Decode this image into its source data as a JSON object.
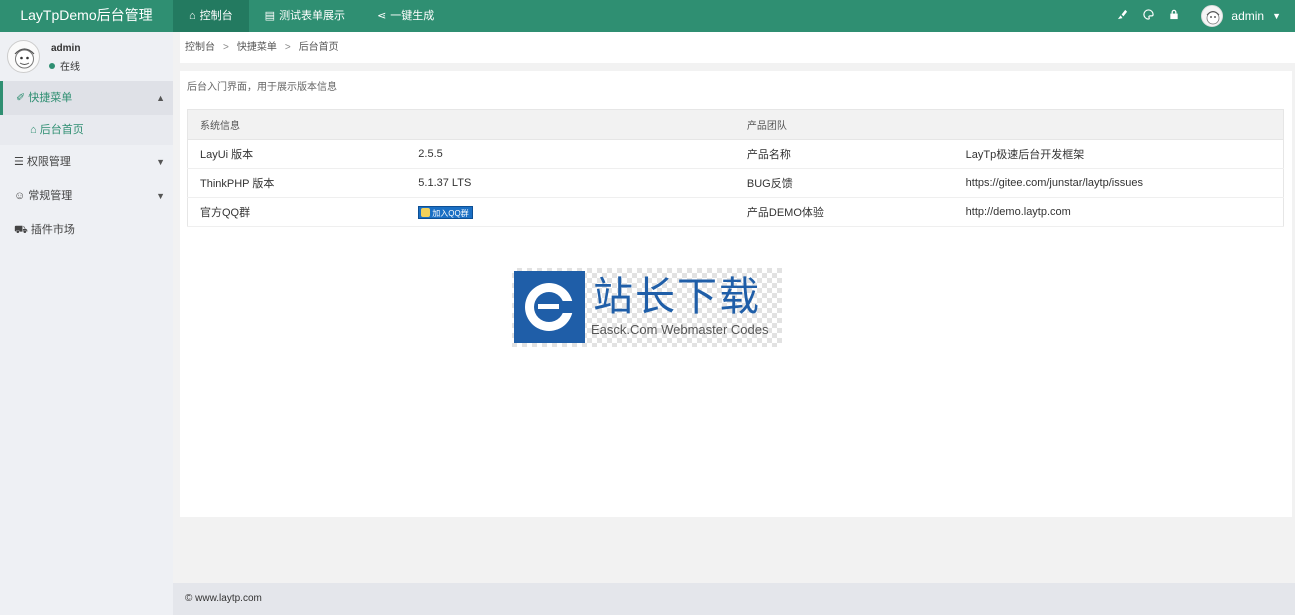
{
  "header": {
    "logo": "LayTpDemo后台管理",
    "nav": [
      {
        "icon": "⌂",
        "label": "控制台"
      },
      {
        "icon": "▤",
        "label": "测试表单展示"
      },
      {
        "icon": "⋖",
        "label": "一键生成"
      }
    ],
    "icons": [
      "broom-icon",
      "palette-icon",
      "lock-icon"
    ],
    "user": {
      "name": "admin"
    }
  },
  "sidebar": {
    "user": {
      "name": "admin",
      "status": "在线"
    },
    "menu": [
      {
        "icon": "✐",
        "label": "快捷菜单",
        "open": true,
        "children": [
          {
            "icon": "⌂",
            "label": "后台首页"
          }
        ]
      },
      {
        "icon": "☰",
        "label": "权限管理"
      },
      {
        "icon": "☺",
        "label": "常规管理"
      },
      {
        "icon": "⛟",
        "label": "插件市场"
      }
    ]
  },
  "breadcrumb": [
    "控制台",
    "快捷菜单",
    "后台首页"
  ],
  "main": {
    "intro": "后台入门界面，用于展示版本信息",
    "table": {
      "headers": [
        "系统信息",
        "产品团队"
      ],
      "rows": [
        [
          "LayUi 版本",
          "2.5.5",
          "产品名称",
          "LayTp极速后台开发框架"
        ],
        [
          "ThinkPHP 版本",
          "5.1.37 LTS",
          "BUG反馈",
          "https://gitee.com/junstar/laytp/issues"
        ],
        [
          "官方QQ群",
          "",
          "产品DEMO体验",
          "http://demo.laytp.com"
        ]
      ],
      "qq_button": "加入QQ群"
    }
  },
  "watermark": {
    "title": "站长下载",
    "subtitle": "Easck.Com Webmaster Codes"
  },
  "footer": "© www.laytp.com",
  "colors": {
    "primary": "#2f8f72",
    "sidebar_bg": "#eef0f4",
    "watermark_blue": "#1f5ea8"
  }
}
